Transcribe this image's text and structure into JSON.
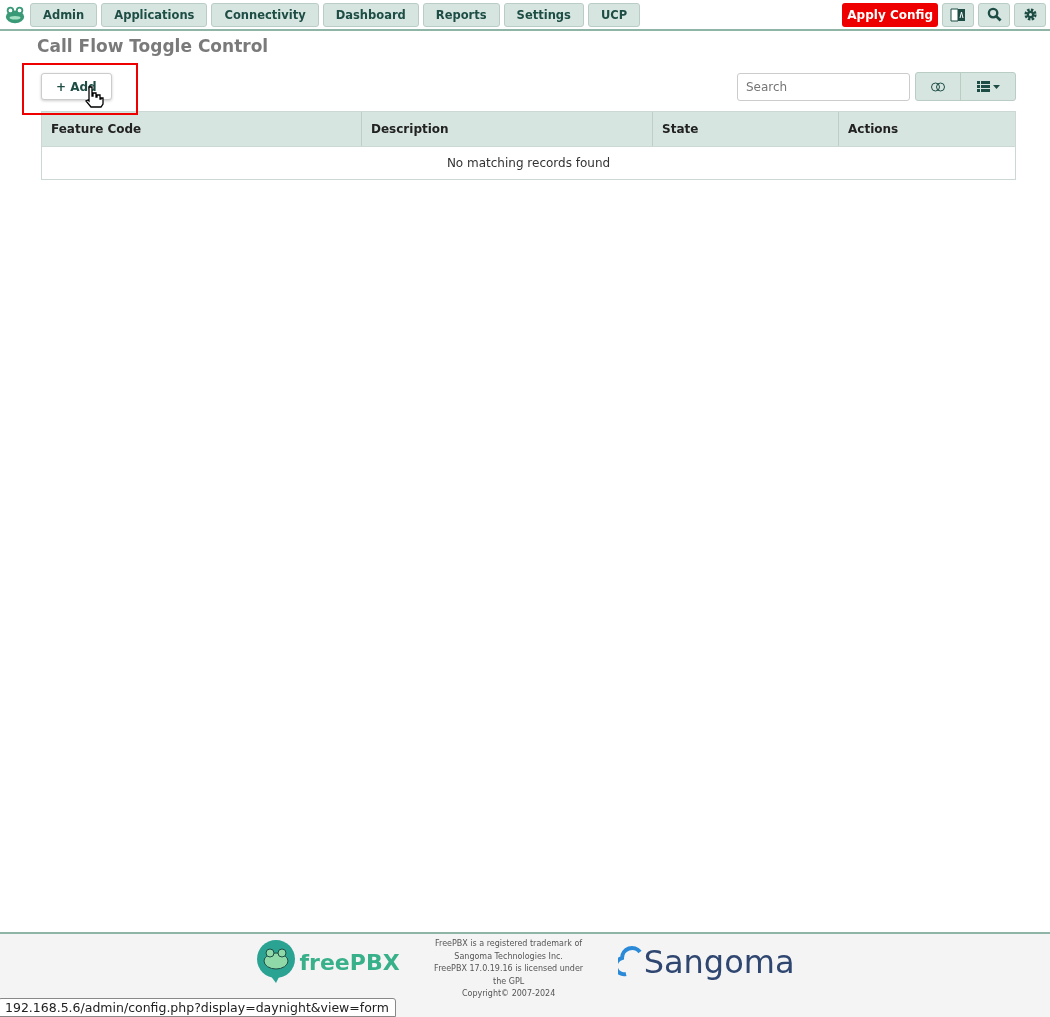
{
  "nav": {
    "tabs": [
      "Admin",
      "Applications",
      "Connectivity",
      "Dashboard",
      "Reports",
      "Settings",
      "UCP"
    ],
    "apply_button": "Apply Config"
  },
  "page": {
    "title": "Call Flow Toggle Control",
    "add_button": "+ Add",
    "add_highlighted": true
  },
  "search": {
    "placeholder": "Search"
  },
  "table": {
    "columns": [
      "Feature Code",
      "Description",
      "State",
      "Actions"
    ],
    "empty_message": "No matching records found"
  },
  "footer": {
    "logo_text": "freePBX",
    "lines": [
      "FreePBX is a registered trademark of",
      "Sangoma Technologies Inc.",
      "FreePBX 17.0.19.16 is licensed under",
      "the GPL",
      "Copyright© 2007-2024"
    ],
    "brand_text": "Sangoma"
  },
  "status_url": "192.168.5.6/admin/config.php?display=daynight&view=form"
}
